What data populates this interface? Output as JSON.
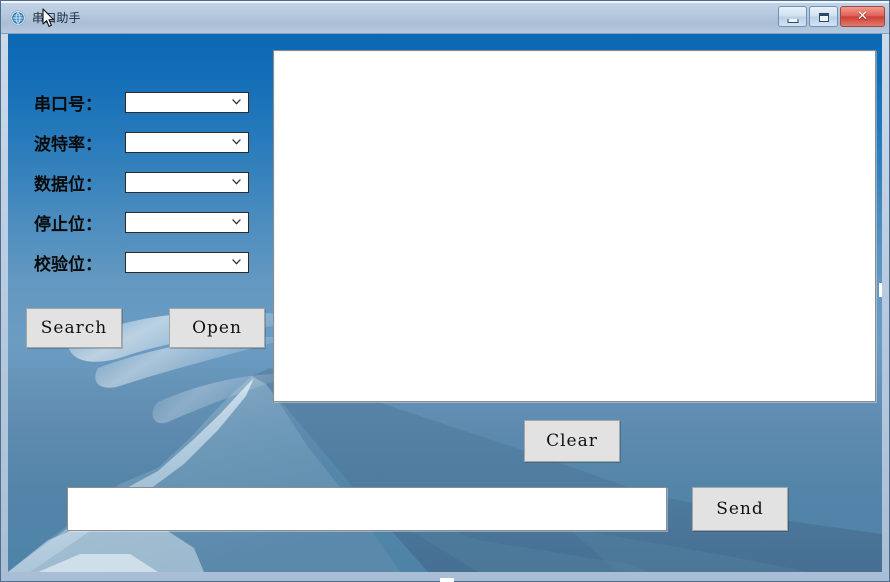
{
  "window": {
    "title": "串口助手",
    "icon": "globe-icon",
    "controls": {
      "minimize_label": "",
      "maximize_label": "",
      "close_label": "✕"
    }
  },
  "form": {
    "fields": [
      {
        "label": "串口号：",
        "value": "",
        "name": "port-number"
      },
      {
        "label": "波特率：",
        "value": "",
        "name": "baud-rate"
      },
      {
        "label": "数据位：",
        "value": "",
        "name": "data-bits"
      },
      {
        "label": "停止位：",
        "value": "",
        "name": "stop-bits"
      },
      {
        "label": "校验位：",
        "value": "",
        "name": "parity-bit"
      }
    ]
  },
  "buttons": {
    "search": "Search",
    "open": "Open",
    "clear": "Clear",
    "send": "Send"
  },
  "receive_area": {
    "text": ""
  },
  "send_area": {
    "value": "",
    "placeholder": ""
  },
  "colors": {
    "titlebar_start": "#c4d4e6",
    "titlebar_end": "#a9bdd6",
    "close_button": "#cf3f37",
    "sky_top": "#0f6fbe",
    "sky_bottom": "#4e83a8",
    "button_face": "#e2e2e2",
    "field_white": "#ffffff",
    "label_text": "#0a0a0a"
  }
}
